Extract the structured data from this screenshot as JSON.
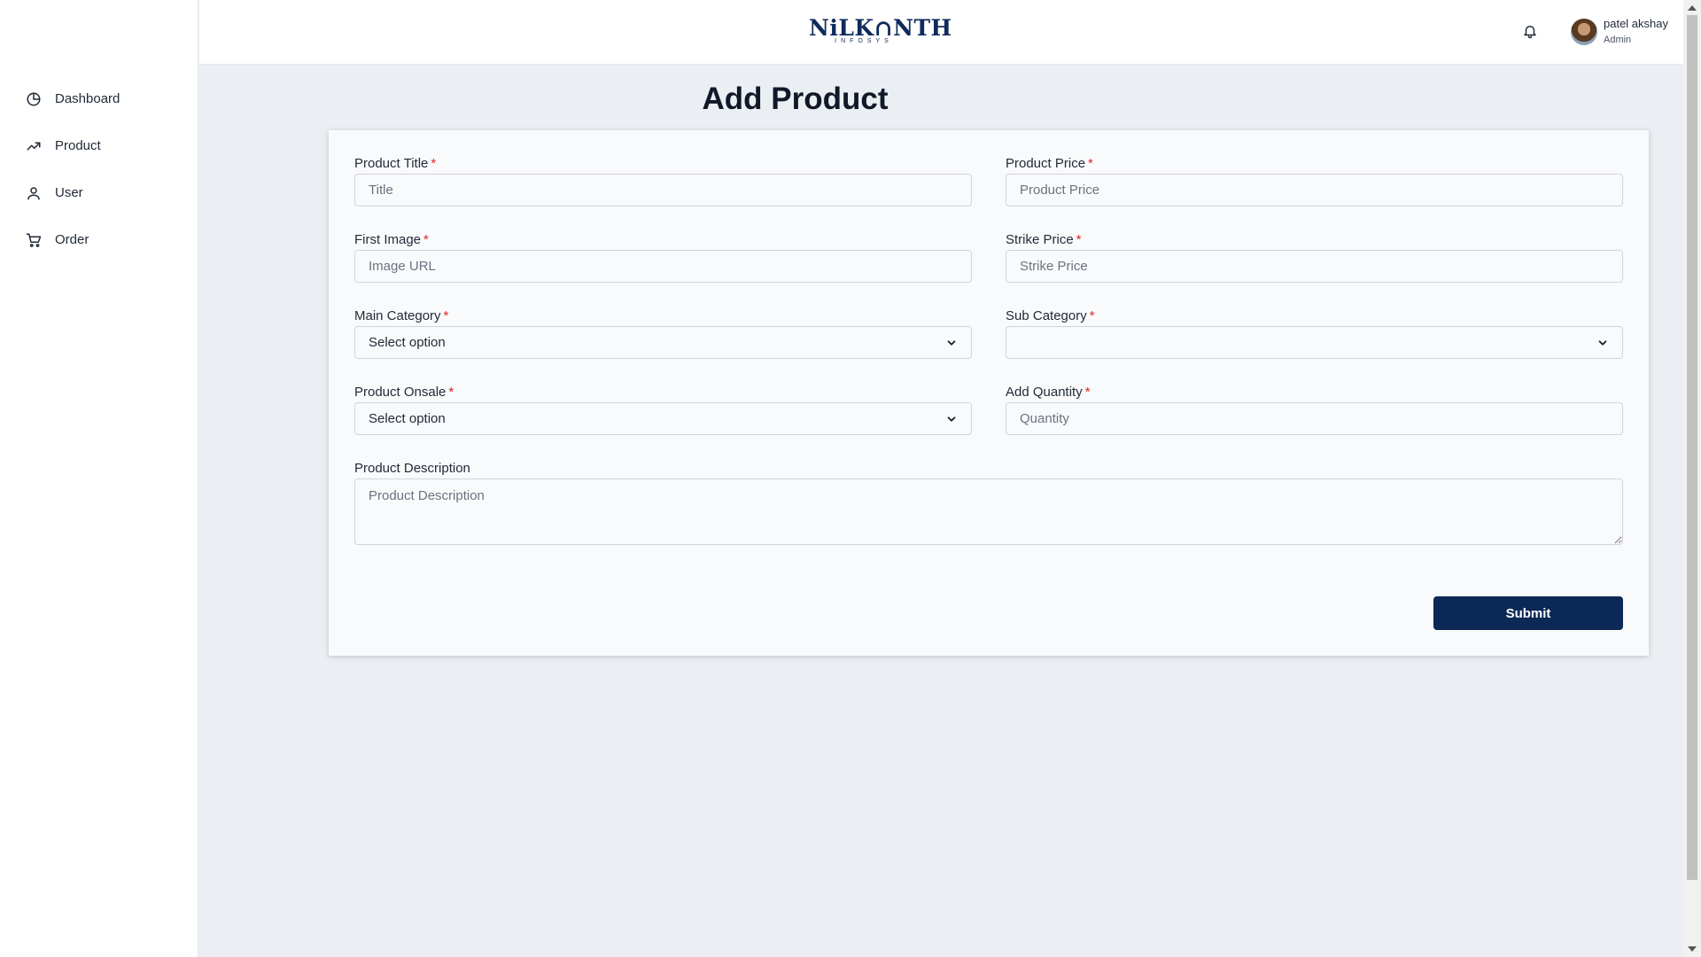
{
  "sidebar": {
    "items": [
      {
        "label": "Dashboard",
        "icon": "pie-chart-icon"
      },
      {
        "label": "Product",
        "icon": "trending-up-icon"
      },
      {
        "label": "User",
        "icon": "user-icon"
      },
      {
        "label": "Order",
        "icon": "shopping-cart-icon"
      }
    ]
  },
  "header": {
    "logo_main": "NiLK∩NTH",
    "logo_sub": "INFOSYS",
    "user_name": "patel akshay",
    "user_role": "Admin"
  },
  "page": {
    "title": "Add Product"
  },
  "form": {
    "required_mark": "*",
    "product_title": {
      "label": "Product Title",
      "placeholder": "Title"
    },
    "product_price": {
      "label": "Product Price",
      "placeholder": "Product Price"
    },
    "first_image": {
      "label": "First Image",
      "placeholder": "Image URL"
    },
    "strike_price": {
      "label": "Strike Price",
      "placeholder": "Strike Price"
    },
    "main_category": {
      "label": "Main Category",
      "value": "Select option"
    },
    "sub_category": {
      "label": "Sub Category",
      "value": ""
    },
    "product_onsale": {
      "label": "Product Onsale",
      "value": "Select option"
    },
    "add_quantity": {
      "label": "Add Quantity",
      "placeholder": "Quantity"
    },
    "product_description": {
      "label": "Product Description",
      "placeholder": "Product Description"
    },
    "submit_label": "Submit"
  },
  "colors": {
    "accent": "#0c2856",
    "required": "#e02424",
    "background": "#ebeff3"
  }
}
